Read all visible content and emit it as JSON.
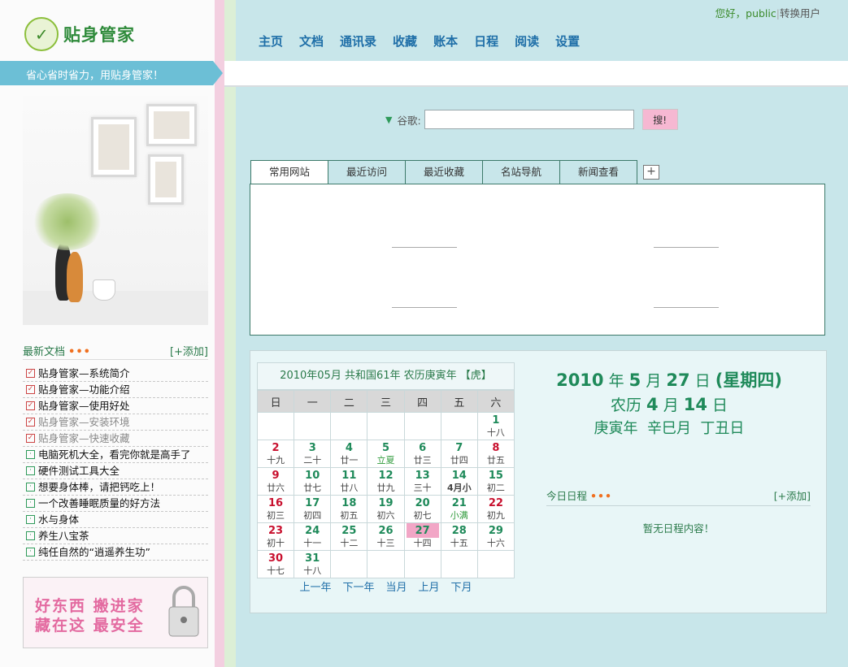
{
  "brand": {
    "name": "贴身管家",
    "slogan": "省心省时省力，用贴身管家！"
  },
  "user": {
    "greeting": "您好，",
    "username": "public",
    "separator": "|",
    "switch_label": "转换用户"
  },
  "nav": [
    "主页",
    "文档",
    "通讯录",
    "收藏",
    "账本",
    "日程",
    "阅读",
    "设置"
  ],
  "search": {
    "engine_label": "谷歌:",
    "button_label": "搜!",
    "value": ""
  },
  "tabs": {
    "items": [
      "常用网站",
      "最近访问",
      "最近收藏",
      "名站导航",
      "新闻查看"
    ],
    "active": 0,
    "add_label": "+"
  },
  "recent_docs": {
    "title": "最新文档",
    "dots": "•••",
    "add_label": "[+添加]",
    "items": [
      {
        "text": "贴身管家—系统简介",
        "type": "check"
      },
      {
        "text": "贴身管家—功能介绍",
        "type": "check"
      },
      {
        "text": "贴身管家—使用好处",
        "type": "check"
      },
      {
        "text": "贴身管家—安装环境",
        "type": "check"
      },
      {
        "text": "贴身管家—快速收藏",
        "type": "check"
      },
      {
        "text": "电脑死机大全，看完你就是高手了",
        "type": "box"
      },
      {
        "text": "硬件测试工具大全",
        "type": "box"
      },
      {
        "text": "想要身体棒，请把钙吃上！",
        "type": "box"
      },
      {
        "text": "一个改善睡眠质量的好方法",
        "type": "box"
      },
      {
        "text": "水与身体",
        "type": "box"
      },
      {
        "text": "养生八宝茶",
        "type": "box"
      },
      {
        "text": "纯任自然的“逍遥养生功”",
        "type": "box"
      }
    ]
  },
  "ad": {
    "line1": "好东西  搬进家",
    "line2": "藏在这  最安全"
  },
  "calendar": {
    "header": "2010年05月  共和国61年  农历庚寅年  【虎】",
    "weekdays": [
      "日",
      "一",
      "二",
      "三",
      "四",
      "五",
      "六"
    ],
    "weeks": [
      [
        null,
        null,
        null,
        null,
        null,
        null,
        {
          "d": "1",
          "l": "十八"
        }
      ],
      [
        {
          "d": "2",
          "l": "十九",
          "red": true
        },
        {
          "d": "3",
          "l": "二十"
        },
        {
          "d": "4",
          "l": "廿一"
        },
        {
          "d": "5",
          "l": "立夏",
          "term": true
        },
        {
          "d": "6",
          "l": "廿三"
        },
        {
          "d": "7",
          "l": "廿四"
        },
        {
          "d": "8",
          "l": "廿五",
          "red": true
        }
      ],
      [
        {
          "d": "9",
          "l": "廿六",
          "red": true
        },
        {
          "d": "10",
          "l": "廿七"
        },
        {
          "d": "11",
          "l": "廿八"
        },
        {
          "d": "12",
          "l": "廿九"
        },
        {
          "d": "13",
          "l": "三十"
        },
        {
          "d": "14",
          "l": "4月小",
          "bold": true
        },
        {
          "d": "15",
          "l": "初二"
        }
      ],
      [
        {
          "d": "16",
          "l": "初三",
          "red": true
        },
        {
          "d": "17",
          "l": "初四"
        },
        {
          "d": "18",
          "l": "初五"
        },
        {
          "d": "19",
          "l": "初六"
        },
        {
          "d": "20",
          "l": "初七"
        },
        {
          "d": "21",
          "l": "小满",
          "term": true
        },
        {
          "d": "22",
          "l": "初九",
          "red": true
        }
      ],
      [
        {
          "d": "23",
          "l": "初十",
          "red": true
        },
        {
          "d": "24",
          "l": "十一"
        },
        {
          "d": "25",
          "l": "十二"
        },
        {
          "d": "26",
          "l": "十三"
        },
        {
          "d": "27",
          "l": "十四",
          "today": true
        },
        {
          "d": "28",
          "l": "十五"
        },
        {
          "d": "29",
          "l": "十六"
        }
      ],
      [
        {
          "d": "30",
          "l": "十七",
          "red": true
        },
        {
          "d": "31",
          "l": "十八"
        },
        null,
        null,
        null,
        null,
        null
      ]
    ],
    "footer": [
      "上一年",
      "下一年",
      "当月",
      "上月",
      "下月"
    ]
  },
  "today": {
    "year": "2010",
    "year_unit": "年",
    "month": "5",
    "month_unit": "月",
    "day": "27",
    "day_unit": "日",
    "weekday": "(星期四)",
    "lunar_prefix": "农历",
    "lunar_month": "4",
    "lunar_month_unit": "月",
    "lunar_day": "14",
    "lunar_day_unit": "日",
    "ganzhi": "庚寅年  辛巳月  丁丑日"
  },
  "schedule": {
    "title": "今日日程",
    "dots": "•••",
    "add_label": "[+添加]",
    "empty_text": "暂无日程内容！"
  },
  "colors": {
    "accent_green": "#1f8a5a",
    "nav_blue": "#1f6fa8",
    "sunday_red": "#c8102e",
    "page_bg": "#c8e6ea"
  }
}
